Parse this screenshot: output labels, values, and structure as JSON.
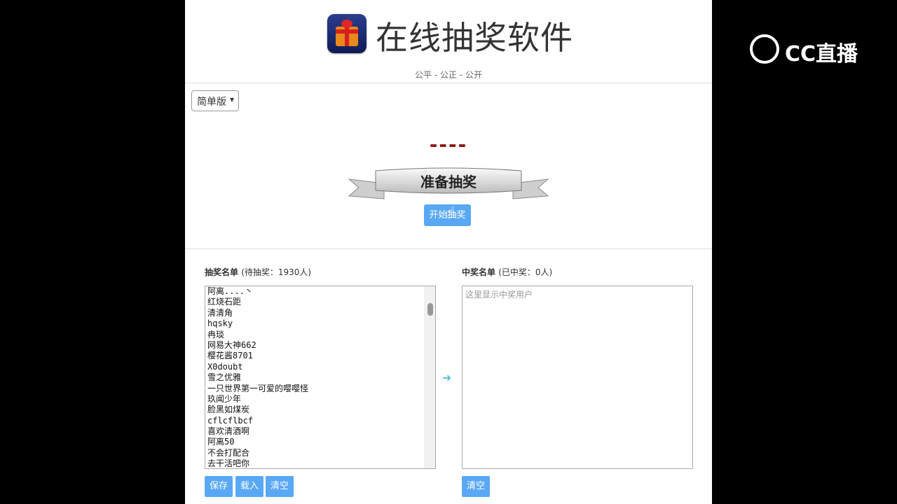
{
  "header": {
    "title": "在线抽奖软件",
    "subtitle": "公平 - 公正 - 公开"
  },
  "mode_select": {
    "selected": "简单版"
  },
  "draw": {
    "display": "----",
    "banner": "准备抽奖",
    "start_button": "开始抽奖"
  },
  "candidates": {
    "title": "抽奖名单",
    "count_text": "(待抽奖：1930人)",
    "items": [
      "阿离....丶",
      "红烧石距",
      "清清角",
      "hqsky",
      "冉琰",
      "网易大神662",
      "樱花酱8701",
      "X0doubt",
      "雪之优雅",
      "一只世界第一可爱的嘤嘤怪",
      "玖闻少年",
      "脸黑如煤炭",
      "cflcflbcf",
      "喜欢清酒啊",
      "阿离50",
      "不会打配合",
      "去干活吧你"
    ],
    "buttons": {
      "save": "保存",
      "load": "载入",
      "clear": "清空"
    }
  },
  "winners": {
    "title": "中奖名单",
    "count_text": "(已中奖：0人)",
    "placeholder": "这里显示中奖用户",
    "buttons": {
      "clear": "清空"
    }
  },
  "watermark": {
    "text": "CC直播"
  },
  "colors": {
    "accent": "#59a8f5",
    "dashes": "#8b1a1a",
    "arrow": "#5bc0de"
  }
}
